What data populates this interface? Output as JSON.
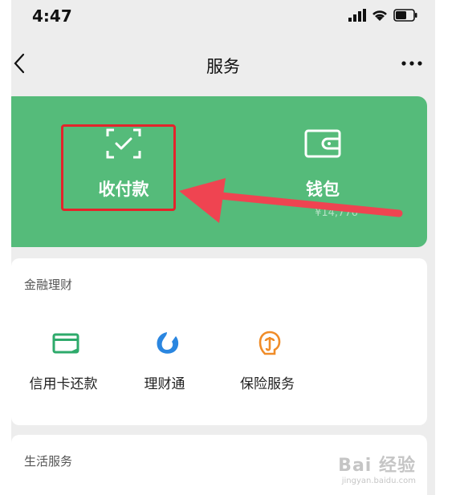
{
  "status_bar": {
    "time": "4:47"
  },
  "nav": {
    "title": "服务"
  },
  "pay_card": {
    "pay": {
      "label": "收付款"
    },
    "wallet": {
      "label": "钱包",
      "amount": "¥14,776"
    }
  },
  "finance": {
    "title": "金融理财",
    "items": [
      {
        "label": "信用卡还款",
        "icon": "credit-card-icon",
        "color": "#2eaa6b"
      },
      {
        "label": "理财通",
        "icon": "wealth-icon",
        "color": "#2a86e0"
      },
      {
        "label": "保险服务",
        "icon": "insurance-icon",
        "color": "#f08c28"
      }
    ]
  },
  "life": {
    "title": "生活服务"
  },
  "watermark": {
    "brand": "Bai 经验",
    "url": "jingyan.baidu.com"
  },
  "colors": {
    "card_green": "#55bb7a",
    "highlight_red": "#e3242b"
  }
}
